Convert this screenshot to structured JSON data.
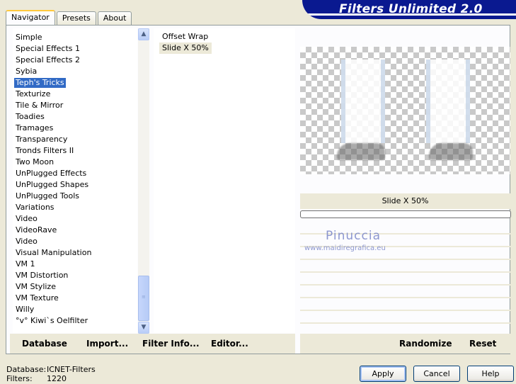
{
  "app": {
    "title": "Filters Unlimited 2.0"
  },
  "tabs": [
    {
      "label": "Navigator",
      "active": true
    },
    {
      "label": "Presets",
      "active": false
    },
    {
      "label": "About",
      "active": false
    }
  ],
  "categories": {
    "selected": "Teph's Tricks",
    "items": [
      "Simple",
      "Special Effects 1",
      "Special Effects 2",
      "Sybia",
      "Teph's Tricks",
      "Texturize",
      "Tile & Mirror",
      "Toadies",
      "Tramages",
      "Transparency",
      "Tronds Filters II",
      "Two Moon",
      "UnPlugged Effects",
      "UnPlugged Shapes",
      "UnPlugged Tools",
      "Variations",
      "Video",
      "VideoRave",
      "Video",
      "Visual Manipulation",
      "VM 1",
      "VM Distortion",
      "VM Stylize",
      "VM Texture",
      "Willy",
      "°v° Kiwi`s Oelfilter"
    ]
  },
  "filters": {
    "selected": "Slide X 50%",
    "items": [
      "Offset Wrap",
      "Slide X 50%"
    ]
  },
  "preview": {
    "filter_name": "Slide X 50%",
    "progress": 0
  },
  "watermark": {
    "name": "Pinuccia",
    "url": "www.maidiregrafica.eu"
  },
  "toolbar": {
    "database": "Database",
    "import": "Import...",
    "filter_info": "Filter Info...",
    "editor": "Editor...",
    "randomize": "Randomize",
    "reset": "Reset"
  },
  "status": {
    "database_label": "Database:",
    "database_value": "ICNET-Filters",
    "filters_label": "Filters:",
    "filters_value": "1220"
  },
  "buttons": {
    "apply": "Apply",
    "cancel": "Cancel",
    "help": "Help"
  },
  "colors": {
    "banner": "#0a1990",
    "selection": "#316ac5",
    "watermark": "#7a86c8"
  }
}
